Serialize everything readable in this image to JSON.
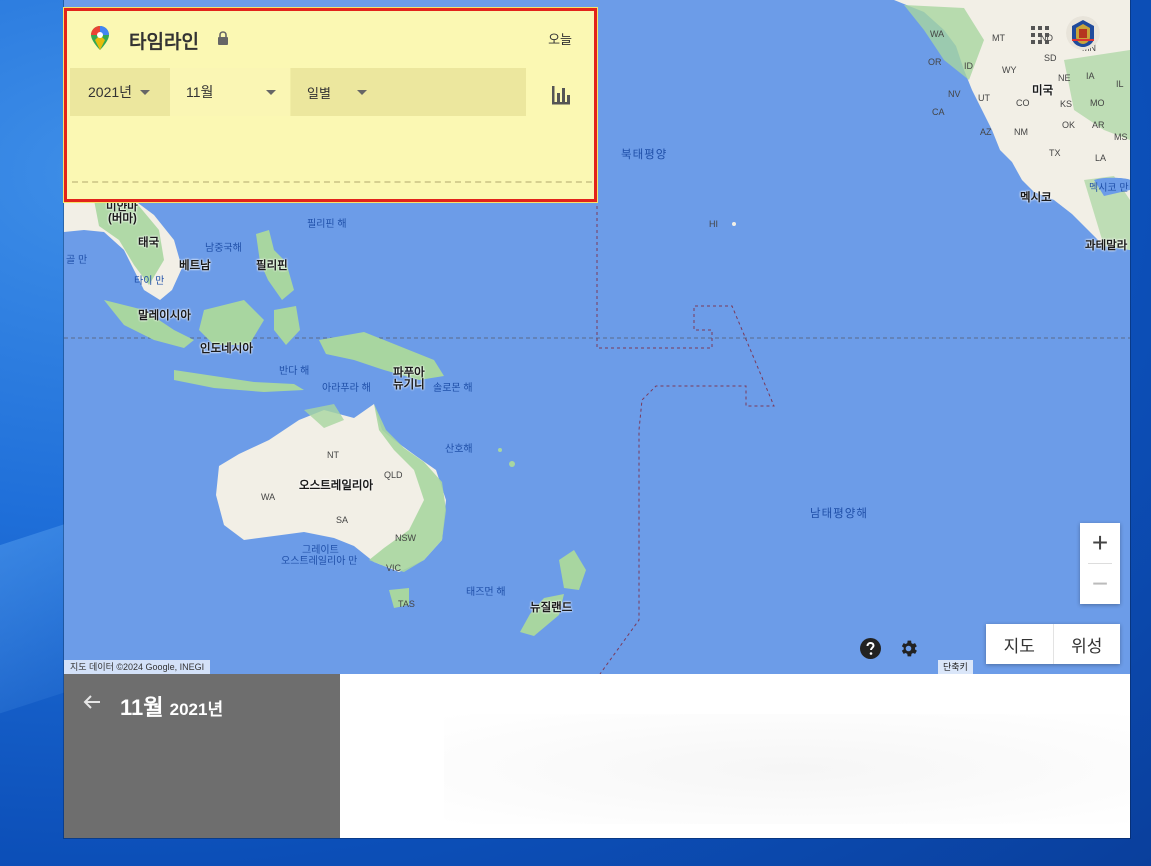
{
  "timeline": {
    "title": "타임라인",
    "today_label": "오늘",
    "year_value": "2021년",
    "month_value": "11월",
    "unit_value": "일별"
  },
  "map_labels": {
    "oceans": {
      "north_pacific": "북태평양",
      "south_pacific": "남태평양해"
    },
    "seas": {
      "philippine": "필리핀 해",
      "south_china": "남중국해",
      "gulf_thailand": "타이 만",
      "gulf_bengal": "골 만",
      "banda": "반다 해",
      "arafura": "아라푸라 해",
      "solomon": "솔로몬 해",
      "coral": "산호해",
      "great_bight_1": "그레이트",
      "great_bight_2": "오스트레일리아 만",
      "tasman": "태즈먼 해",
      "gulf_mexico": "멕시코 만"
    },
    "countries": {
      "myanmar_1": "미얀마",
      "myanmar_2": "(버마)",
      "thailand": "태국",
      "vietnam": "베트남",
      "philippines": "필리핀",
      "malaysia": "말레이시아",
      "indonesia": "인도네시아",
      "png_1": "파푸아",
      "png_2": "뉴기니",
      "australia": "오스트레일리아",
      "new_zealand": "뉴질랜드",
      "usa": "미국",
      "mexico": "멕시코",
      "guatemala": "과테말라"
    },
    "states": {
      "nt": "NT",
      "qld": "QLD",
      "wa_au": "WA",
      "sa": "SA",
      "nsw": "NSW",
      "vic": "VIC",
      "tas": "TAS",
      "hi": "HI",
      "wa_us": "WA",
      "or": "OR",
      "mt": "MT",
      "id": "ID",
      "wy": "WY",
      "nv": "NV",
      "ut": "UT",
      "co": "CO",
      "ca": "CA",
      "az": "AZ",
      "nm": "NM",
      "tx": "TX",
      "ks": "KS",
      "ok": "OK",
      "ne": "NE",
      "sd": "SD",
      "ia": "IA",
      "il": "IL",
      "mo": "MO",
      "ar": "AR",
      "ms": "MS",
      "la": "LA",
      "nd": "ND",
      "mn": "MN"
    }
  },
  "controls": {
    "zoom_in": "+",
    "zoom_out": "−",
    "map_type_map": "지도",
    "map_type_satellite": "위성",
    "attribution": "지도 데이터 ©2024 Google, INEGI",
    "shortcut": "단축키"
  },
  "bottom": {
    "month": "11월",
    "year": "2021년"
  },
  "colors": {
    "panel_bg": "#fbf8b3",
    "highlight_border": "#e2231a",
    "ocean": "#6c9ce8",
    "land": "#f2efe6",
    "vegetation": "#a8d6a0"
  }
}
